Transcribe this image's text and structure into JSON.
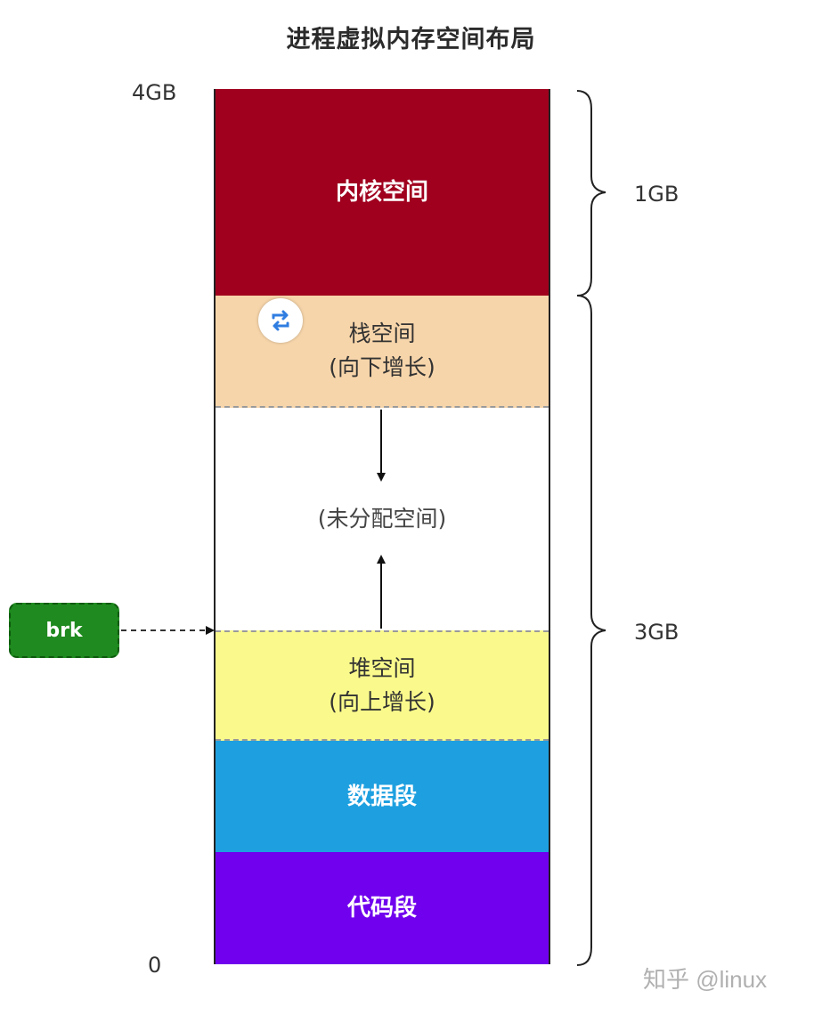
{
  "title": "进程虚拟内存空间布局",
  "addresses": {
    "top": "4GB",
    "bottom": "0"
  },
  "segments": [
    {
      "lines": [
        "内核空间"
      ],
      "color": "#a0001e"
    },
    {
      "lines": [
        "栈空间",
        "(向下增长)"
      ],
      "color": "#f7d5aa"
    },
    {
      "lines": [
        "(未分配空间)"
      ],
      "color": "#ffffff"
    },
    {
      "lines": [
        "堆空间",
        "(向上增长)"
      ],
      "color": "#fafa8c"
    },
    {
      "lines": [
        "数据段"
      ],
      "color": "#1ea0e0"
    },
    {
      "lines": [
        "代码段"
      ],
      "color": "#7000ee"
    }
  ],
  "pointer": {
    "label": "brk",
    "color": "#1f8a1f"
  },
  "braces": {
    "kernel": "1GB",
    "user": "3GB"
  },
  "watermark": "知乎 @linux",
  "icons": {
    "sync": "sync-icon"
  }
}
